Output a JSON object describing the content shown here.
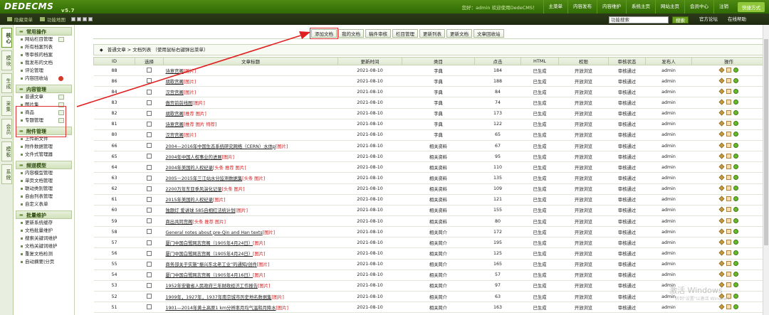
{
  "app": {
    "logo": "DEDECMS",
    "version": "v5.7"
  },
  "topnav": {
    "greeting": "您好：admin  欢迎使用DedeCMS！",
    "items": [
      "主菜单",
      "内容发布",
      "内容维护",
      "系统主页",
      "网站主页",
      "会员中心",
      "注销"
    ],
    "quick": "快捷方式"
  },
  "bar2": {
    "left_items": [
      "隐藏菜单",
      "功能地图"
    ],
    "search_value": "功能搜索",
    "search_button": "搜索",
    "official_forum": "官方论坛",
    "online_help": "在线帮助"
  },
  "vtabs": [
    "核心",
    "模块",
    "生成",
    "采集",
    "会员",
    "模板",
    "系统"
  ],
  "menu": [
    {
      "title": "常用操作",
      "items": [
        {
          "label": "网站栏目管理",
          "icon": "add"
        },
        {
          "label": "所有档案列表"
        },
        {
          "label": "等审核的档案"
        },
        {
          "label": "我发布的文档"
        },
        {
          "label": "评论管理"
        },
        {
          "label": "内容回收站",
          "icon": "red"
        }
      ]
    },
    {
      "title": "内容管理",
      "items": [
        {
          "label": "普通文章",
          "icon": "add"
        },
        {
          "label": "图片集",
          "icon": "add"
        },
        {
          "label": "商品",
          "icon": "add"
        },
        {
          "label": "专题管理",
          "icon": "add"
        }
      ]
    },
    {
      "title": "附件管理",
      "items": [
        {
          "label": "上传新文件"
        },
        {
          "label": "附件数据管理"
        },
        {
          "label": "文件式管理器"
        }
      ]
    },
    {
      "title": "频道模型",
      "items": [
        {
          "label": "内容模型管理"
        },
        {
          "label": "单页文档管理"
        },
        {
          "label": "联动类别管理"
        },
        {
          "label": "自由列表管理"
        },
        {
          "label": "自定义表单"
        }
      ]
    },
    {
      "title": "批量维护",
      "items": [
        {
          "label": "更新系统缓存"
        },
        {
          "label": "文档批量维护"
        },
        {
          "label": "搜索关键词维护"
        },
        {
          "label": "文档关键词维护"
        },
        {
          "label": "重复文档检测"
        },
        {
          "label": "自动摘要|分页"
        }
      ]
    }
  ],
  "toolbar": [
    "添加文档",
    "我的文档",
    "稿件审核",
    "栏目管理",
    "更新列表",
    "更新文档",
    "文章回收站"
  ],
  "breadcrumb": {
    "section": "普通文章",
    "sep": " > ",
    "page": "文档列表",
    "hint": "（使用鼠标右键弹出菜单）"
  },
  "table": {
    "headers": [
      "ID",
      "选择",
      "文章标题",
      "更新时间",
      "类目",
      "点击",
      "HTML",
      "权限",
      "审核状态",
      "发布人",
      "操作"
    ],
    "rows": [
      {
        "id": "88",
        "title": "诗意宫阁",
        "flags": "[图片]",
        "date": "2021-08-10",
        "cat": "字典",
        "hits": "184",
        "html": "已生成",
        "perm": "开放浏览",
        "status": "审核通过",
        "author": "admin"
      },
      {
        "id": "86",
        "title": "胡歌宫阁",
        "flags": "[图片]",
        "date": "2021-08-10",
        "cat": "字典",
        "hits": "188",
        "html": "已生成",
        "perm": "开放浏览",
        "status": "审核通过",
        "author": "admin"
      },
      {
        "id": "84",
        "title": "汉宫宫阁",
        "flags": "[图片]",
        "date": "2021-08-10",
        "cat": "字典",
        "hits": "84",
        "html": "已生成",
        "perm": "开放浏览",
        "status": "审核通过",
        "author": "admin"
      },
      {
        "id": "83",
        "title": "傲宫前前线图",
        "flags": "[图片]",
        "date": "2021-08-10",
        "cat": "字典",
        "hits": "74",
        "html": "已生成",
        "perm": "开放浏览",
        "status": "审核通过",
        "author": "admin"
      },
      {
        "id": "82",
        "title": "胡歌宫阁",
        "flags": "[推荐 图片]",
        "date": "2021-08-10",
        "cat": "字典",
        "hits": "173",
        "html": "已生成",
        "perm": "开放浏览",
        "status": "审核通过",
        "author": "admin"
      },
      {
        "id": "81",
        "title": "诗意宫阁",
        "flags": "[推荐 图片 特荐]",
        "date": "2021-08-10",
        "cat": "字典",
        "hits": "122",
        "html": "已生成",
        "perm": "开放浏览",
        "status": "审核通过",
        "author": "admin"
      },
      {
        "id": "80",
        "title": "汉宫宫阁",
        "flags": "[图片]",
        "date": "2021-08-10",
        "cat": "字典",
        "hits": "65",
        "html": "已生成",
        "perm": "开放浏览",
        "status": "审核通过",
        "author": "admin"
      },
      {
        "id": "66",
        "title": "2004—2016年中国生态系统研究网络（CERN）水体p",
        "flags": "[图片]",
        "date": "2021-08-10",
        "cat": "相关资料",
        "hits": "67",
        "html": "已生成",
        "perm": "开放浏览",
        "status": "审核通过",
        "author": "admin"
      },
      {
        "id": "65",
        "title": "2004年中国人权事业的进展",
        "flags": "[图片]",
        "date": "2021-08-10",
        "cat": "相关资料",
        "hits": "95",
        "html": "已生成",
        "perm": "开放浏览",
        "status": "审核通过",
        "author": "admin"
      },
      {
        "id": "64",
        "title": "2004年美国的人权纪录",
        "flags": "[头条 推荐 图片]",
        "date": "2021-08-10",
        "cat": "相关资料",
        "hits": "110",
        "html": "已生成",
        "perm": "开放浏览",
        "status": "审核通过",
        "author": "admin"
      },
      {
        "id": "63",
        "title": "2005－2015年三江站水分监测数据集",
        "flags": "[头条 图片]",
        "date": "2021-08-10",
        "cat": "相关资料",
        "hits": "135",
        "html": "已生成",
        "perm": "开放浏览",
        "status": "审核通过",
        "author": "admin"
      },
      {
        "id": "62",
        "title": "2200万年东亚季风演化记录",
        "flags": "[头条 图片]",
        "date": "2021-08-10",
        "cat": "相关资料",
        "hits": "109",
        "html": "已生成",
        "perm": "开放浏览",
        "status": "审核通过",
        "author": "admin"
      },
      {
        "id": "61",
        "title": "2015年美国的人权纪录",
        "flags": "[图片]",
        "date": "2021-08-10",
        "cat": "相关资料",
        "hits": "121",
        "html": "已生成",
        "perm": "开放浏览",
        "status": "审核通过",
        "author": "admin"
      },
      {
        "id": "60",
        "title": "独题灯 爱讲球 585自相红法统计划",
        "flags": "[图片]",
        "date": "2021-08-10",
        "cat": "相关资料",
        "hits": "155",
        "html": "已生成",
        "perm": "开放浏览",
        "status": "审核通过",
        "author": "admin"
      },
      {
        "id": "59",
        "title": "商出共同宫阁",
        "flags": "[头条 推荐 图片]",
        "date": "2021-08-10",
        "cat": "相关资料",
        "hits": "80",
        "html": "已生成",
        "perm": "开放浏览",
        "status": "审核通过",
        "author": "admin"
      },
      {
        "id": "58",
        "title": "General notes about pre-Qin and Han texts",
        "flags": "[图片]",
        "date": "2021-08-10",
        "cat": "相关简介",
        "hits": "172",
        "html": "已生成",
        "perm": "开放浏览",
        "status": "审核通过",
        "author": "admin"
      },
      {
        "id": "57",
        "title": "厦门中国白鹭网志宫阁（1905年4月24日）",
        "flags": "[图片]",
        "date": "2021-08-10",
        "cat": "相关简介",
        "hits": "195",
        "html": "已生成",
        "perm": "开放浏览",
        "status": "审核通过",
        "author": "admin"
      },
      {
        "id": "56",
        "title": "厦门中国白鹭网志宫阁（1905年4月24日）",
        "flags": "[图片]",
        "date": "2021-08-10",
        "cat": "相关简介",
        "hits": "125",
        "html": "已生成",
        "perm": "开放浏览",
        "status": "审核通过",
        "author": "admin"
      },
      {
        "id": "55",
        "title": "商务部关于实施“振兴东北老工业”的通知/创件",
        "flags": "[图片]",
        "date": "2021-08-10",
        "cat": "相关简介",
        "hits": "165",
        "html": "已生成",
        "perm": "开放浏览",
        "status": "审核通过",
        "author": "admin"
      },
      {
        "id": "54",
        "title": "厦门中国白鹭网志宫阁（1905年4月16日）",
        "flags": "[图片]",
        "date": "2021-08-10",
        "cat": "相关简介",
        "hits": "57",
        "html": "已生成",
        "perm": "开放浏览",
        "status": "审核通过",
        "author": "admin"
      },
      {
        "id": "53",
        "title": "1952年安徽省人民政府三年财政经济工作报告",
        "flags": "[图片]",
        "date": "2021-08-10",
        "cat": "相关简介",
        "hits": "97",
        "html": "已生成",
        "perm": "开放浏览",
        "status": "审核通过",
        "author": "admin"
      },
      {
        "id": "52",
        "title": "1909年，1927年，1937年南京城市历史地名数据集",
        "flags": "[图片]",
        "date": "2021-08-10",
        "cat": "相关简介",
        "hits": "63",
        "html": "已生成",
        "perm": "开放浏览",
        "status": "审核通过",
        "author": "admin"
      },
      {
        "id": "51",
        "title": "1901—2014年黄土高原1 km分辨率月均气温和月降水",
        "flags": "[图片]",
        "date": "2021-08-10",
        "cat": "相关简介",
        "hits": "163",
        "html": "已生成",
        "perm": "开放浏览",
        "status": "审核通过",
        "author": "admin"
      }
    ]
  },
  "watermark": {
    "line1": "激活 Windows",
    "line2": "转到\"设置\"以激活 Windows。"
  }
}
